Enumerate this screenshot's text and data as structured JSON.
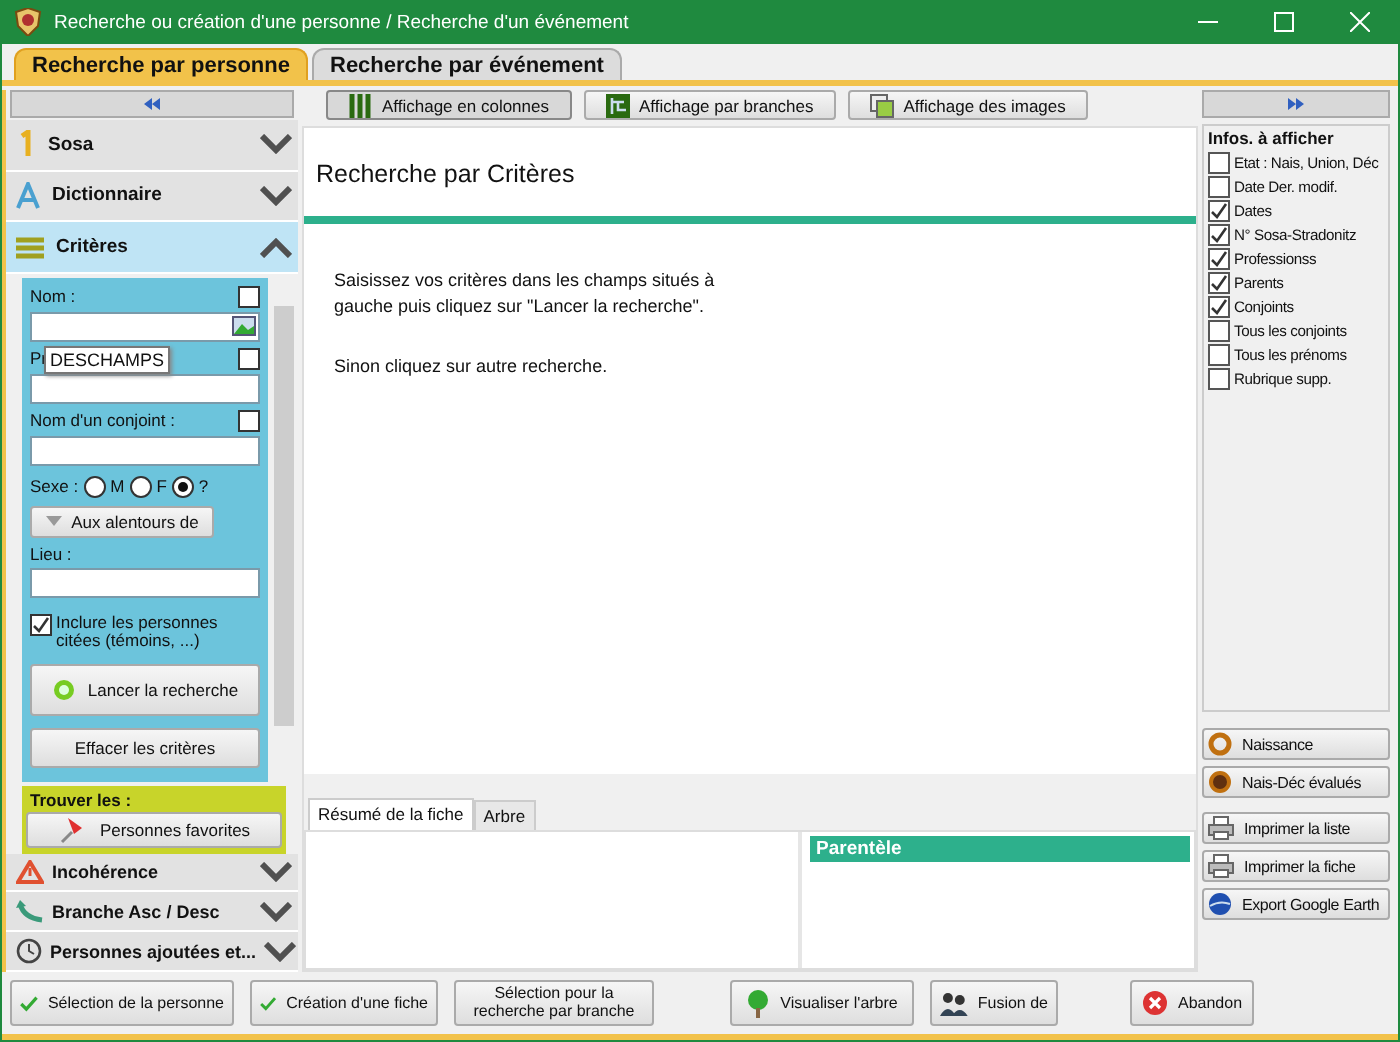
{
  "window": {
    "title": "Recherche ou création d'une personne / Recherche d'un événement"
  },
  "tabs": [
    {
      "label": "Recherche par personne",
      "selected": true
    },
    {
      "label": "Recherche par événement",
      "selected": false
    }
  ],
  "sidebar": {
    "sections_top": [
      {
        "label": "Sosa",
        "expanded": false
      },
      {
        "label": "Dictionnaire",
        "expanded": false
      },
      {
        "label": "Critères",
        "expanded": true
      }
    ],
    "criteria": {
      "nom_label": "Nom :",
      "nom_checked": false,
      "nom_tooltip": "DESCHAMPS",
      "prenom_label": "Pr",
      "prenom_checked": false,
      "conjoint_label": "Nom d'un conjoint :",
      "conjoint_checked": false,
      "sexe_label": "Sexe :",
      "sexes": [
        {
          "label": "M",
          "selected": false
        },
        {
          "label": "F",
          "selected": false
        },
        {
          "label": "?",
          "selected": true
        }
      ],
      "around_button": "Aux alentours de",
      "lieu_label": "Lieu :",
      "include_label": "Inclure les personnes citées (témoins, ...)",
      "include_checked": true,
      "search_button": "Lancer la recherche",
      "clear_button": "Effacer les critères"
    },
    "find": {
      "title": "Trouver les :",
      "button": "Personnes favorites"
    },
    "sections_bottom": [
      {
        "label": "Incohérence",
        "expanded": false
      },
      {
        "label": "Branche Asc / Desc",
        "expanded": false
      },
      {
        "label": "Personnes ajoutées et...",
        "expanded": false
      }
    ]
  },
  "toolbar": [
    {
      "label": "Affichage en colonnes",
      "selected": true
    },
    {
      "label": "Affichage par branches",
      "selected": false
    },
    {
      "label": "Affichage des images",
      "selected": false
    }
  ],
  "main": {
    "title": "Recherche par Critères",
    "paragraphs": [
      "Saisissez vos critères dans les champs situés à gauche puis cliquez sur \"Lancer la recherche\".",
      "Sinon cliquez sur autre recherche."
    ]
  },
  "detail_tabs": [
    {
      "label": "Résumé de la fiche",
      "selected": true
    },
    {
      "label": "Arbre",
      "selected": false
    }
  ],
  "parentele": {
    "title": "Parentèle"
  },
  "infos": {
    "title": "Infos. à afficher",
    "items": [
      {
        "label": "Etat : Nais, Union, Déc",
        "checked": false
      },
      {
        "label": "Date Der. modif.",
        "checked": false
      },
      {
        "label": "Dates",
        "checked": true
      },
      {
        "label": "N° Sosa-Stradonitz",
        "checked": true
      },
      {
        "label": "Professionss",
        "checked": true
      },
      {
        "label": "Parents",
        "checked": true
      },
      {
        "label": "Conjoints",
        "checked": true
      },
      {
        "label": "Tous les conjoints",
        "checked": false
      },
      {
        "label": "Tous les prénoms",
        "checked": false
      },
      {
        "label": "Rubrique supp.",
        "checked": false
      }
    ]
  },
  "side_buttons": [
    "Naissance",
    "Nais-Déc évalués",
    "Imprimer la liste",
    "Imprimer la fiche",
    "Export Google Earth"
  ],
  "bottom_buttons": [
    "Sélection de la personne",
    "Création d'une fiche",
    "Sélection pour la recherche par branche",
    "Visualiser l'arbre",
    "Fusion de",
    "Abandon"
  ]
}
